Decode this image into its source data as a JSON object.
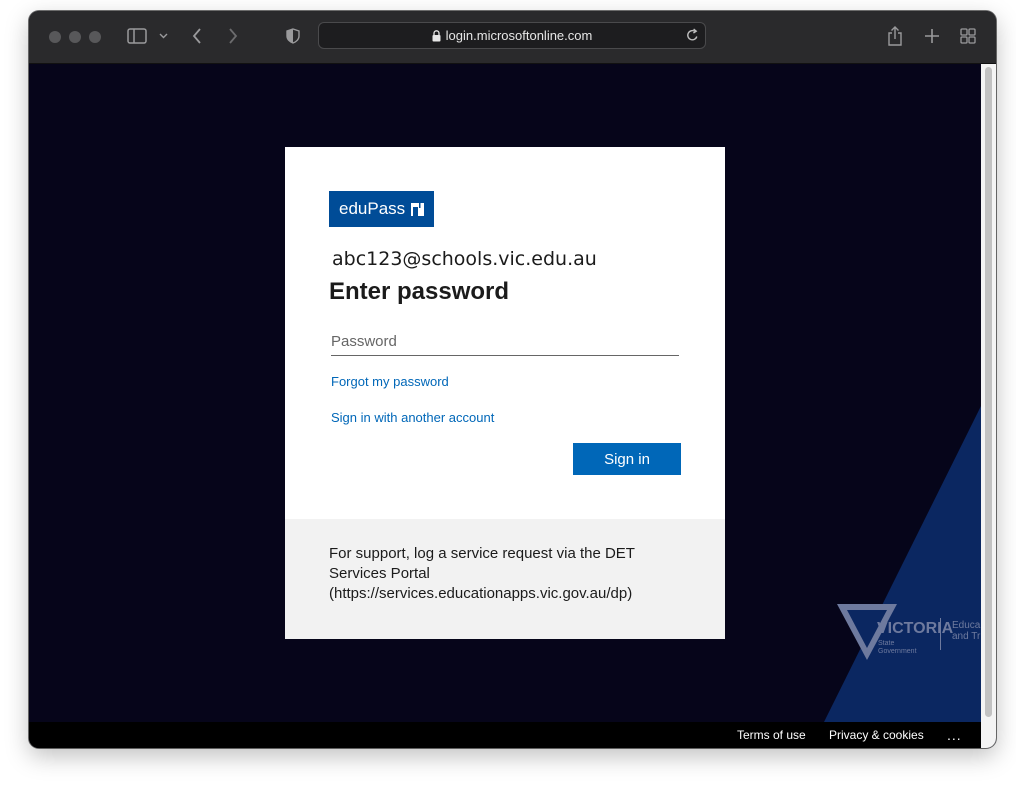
{
  "browser": {
    "url": "login.microsoftonline.com",
    "icons": [
      "sidebar-icon",
      "chevron-down-icon",
      "back-icon",
      "forward-icon",
      "shield-icon",
      "lock-icon",
      "reload-icon",
      "share-icon",
      "new-tab-icon",
      "tab-overview-icon"
    ]
  },
  "card": {
    "logo_text": "eduPass",
    "email": "abc123@schools.vic.edu.au",
    "heading": "Enter password",
    "password_placeholder": "Password",
    "password_value": "",
    "forgot_link": "Forgot my password",
    "other_account_link": "Sign in with another account",
    "signin_button": "Sign in",
    "support_text": "For support, log a service request via the DET Services Portal (https://services.educationapps.vic.gov.au/dp)"
  },
  "branding": {
    "wordmark": "VICTORIA",
    "sub_line1": "State",
    "sub_line2": "Government",
    "dept_line1": "Educa",
    "dept_line2": "and Tr"
  },
  "footer": {
    "terms": "Terms of use",
    "privacy": "Privacy & cookies",
    "more": "..."
  },
  "colors": {
    "background": "#06051a",
    "wedge": "#0b2761",
    "accent": "#0067b8",
    "logo_bg": "#004c97",
    "support_bg": "#f2f2f2"
  }
}
